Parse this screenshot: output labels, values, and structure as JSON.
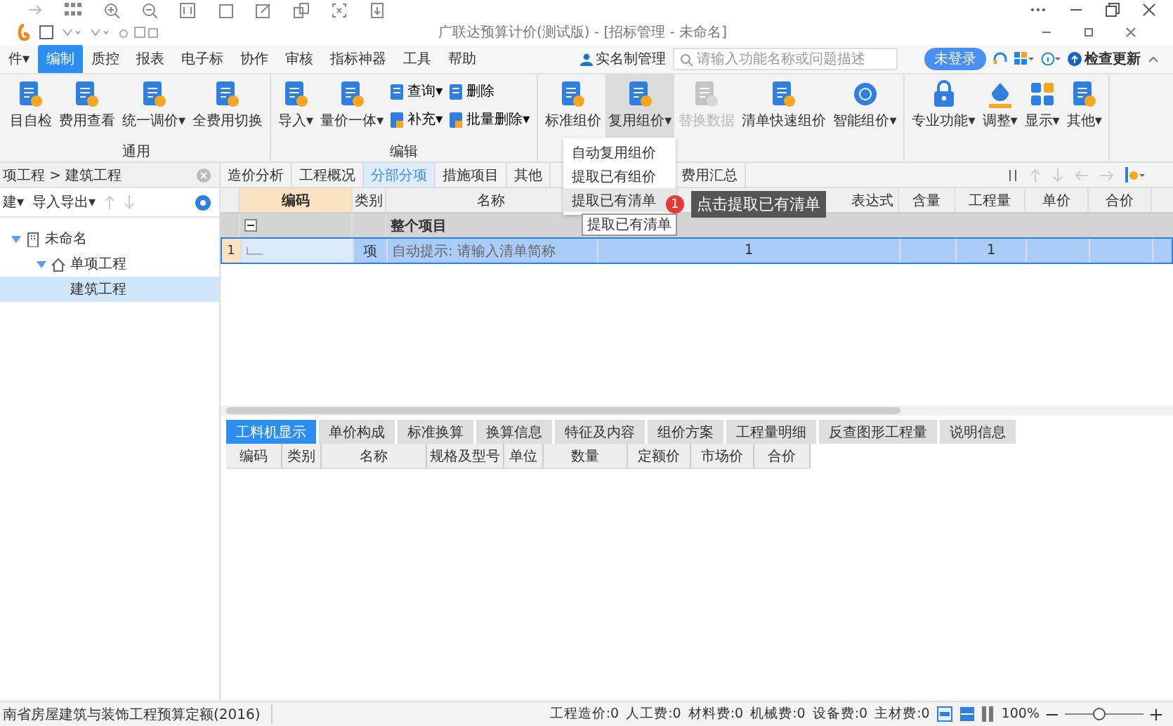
{
  "window": {
    "title": "广联达预算计价(测试版) - [招标管理 - 未命名]"
  },
  "menu": [
    {
      "label": "件▾",
      "selected": false
    },
    {
      "label": "编制",
      "selected": true
    },
    {
      "label": "质控",
      "selected": false
    },
    {
      "label": "报表",
      "selected": false
    },
    {
      "label": "电子标",
      "selected": false
    },
    {
      "label": "协作",
      "selected": false
    },
    {
      "label": "审核",
      "selected": false
    },
    {
      "label": "指标神器",
      "selected": false
    },
    {
      "label": "工具",
      "selected": false
    },
    {
      "label": "帮助",
      "selected": false
    }
  ],
  "account": {
    "realname": "实名制管理",
    "search_placeholder": "请输入功能名称或问题描述",
    "login": "未登录",
    "update": "检查更新"
  },
  "ribbon": [
    {
      "label": "通用",
      "items": [
        {
          "kind": "large",
          "label": "目自检",
          "active": false,
          "disabled": false
        },
        {
          "kind": "large",
          "label": "费用查看",
          "active": false,
          "disabled": false
        },
        {
          "kind": "large",
          "label": "统一调价▾",
          "active": false,
          "disabled": false
        },
        {
          "kind": "large",
          "label": "全费用切换",
          "active": false,
          "disabled": false
        }
      ]
    },
    {
      "label": "编辑",
      "items": [
        {
          "kind": "large",
          "label": "导入▾",
          "active": false,
          "disabled": false
        },
        {
          "kind": "large",
          "label": "量价一体▾",
          "active": false,
          "disabled": false
        },
        {
          "kind": "small",
          "top": "查询▾",
          "bottom": "补充▾"
        },
        {
          "kind": "small",
          "top": "删除",
          "bottom": "批量删除▾"
        }
      ]
    },
    {
      "items": [
        {
          "kind": "large",
          "label": "标准组价",
          "active": false,
          "disabled": false
        },
        {
          "kind": "large",
          "label": "复用组价▾",
          "active": true,
          "disabled": false
        },
        {
          "kind": "large",
          "label": "替换数据",
          "active": false,
          "disabled": true
        },
        {
          "kind": "large",
          "label": "清单快速组价",
          "active": false,
          "disabled": false
        },
        {
          "kind": "large",
          "label": "智能组价▾",
          "active": false,
          "disabled": false
        }
      ]
    },
    {
      "items": [
        {
          "kind": "large",
          "label": "专业功能▾",
          "active": false,
          "disabled": false
        },
        {
          "kind": "large",
          "label": "调整▾",
          "active": false,
          "disabled": false
        },
        {
          "kind": "large",
          "label": "显示▾",
          "active": false,
          "disabled": false
        },
        {
          "kind": "large",
          "label": "其他▾",
          "active": false,
          "disabled": false
        }
      ]
    }
  ],
  "dropdown": [
    {
      "label": "自动复用组价",
      "selected": false
    },
    {
      "label": "提取已有组价",
      "selected": false
    },
    {
      "label": "提取已有清单",
      "selected": true
    }
  ],
  "tooltip": "提取已有清单",
  "callout": {
    "badge": "1",
    "text": "点击提取已有清单"
  },
  "sidebar": {
    "breadcrumb": "项工程 > 建筑工程",
    "toolbar": [
      "建▾",
      "导入导出▾"
    ],
    "tree": [
      {
        "label": "未命名",
        "expanded": true,
        "selected": false,
        "children": [
          {
            "label": "单项工程",
            "expanded": true,
            "selected": false,
            "children": [
              {
                "label": "建筑工程",
                "selected": true
              }
            ]
          }
        ]
      }
    ]
  },
  "tabs": [
    {
      "label": "造价分析",
      "selected": false
    },
    {
      "label": "工程概况",
      "selected": false
    },
    {
      "label": "分部分项",
      "selected": true
    },
    {
      "label": "措施项目",
      "selected": false
    },
    {
      "label": "其他",
      "selected": false
    },
    {
      "label": "费用汇总",
      "selected": false
    }
  ],
  "grid": {
    "columns": [
      "编码",
      "类别",
      "名称",
      "表达式",
      "含量",
      "工程量",
      "单价",
      "合价"
    ],
    "rows": [
      {
        "kind": "group",
        "expanded": true,
        "name": "整个项目"
      },
      {
        "kind": "item",
        "index": "1",
        "type": "项",
        "name": "自动提示: 请输入清单简称",
        "expr": "1",
        "quantity": "1",
        "selected": true
      }
    ]
  },
  "bottom_tabs": [
    {
      "label": "工料机显示",
      "selected": true
    },
    {
      "label": "单价构成",
      "selected": false
    },
    {
      "label": "标准换算",
      "selected": false
    },
    {
      "label": "换算信息",
      "selected": false
    },
    {
      "label": "特征及内容",
      "selected": false
    },
    {
      "label": "组价方案",
      "selected": false
    },
    {
      "label": "工程量明细",
      "selected": false
    },
    {
      "label": "反查图形工程量",
      "selected": false
    },
    {
      "label": "说明信息",
      "selected": false
    }
  ],
  "bottom_columns": [
    "编码",
    "类别",
    "名称",
    "规格及型号",
    "单位",
    "数量",
    "定额价",
    "市场价",
    "合价"
  ],
  "status_bar": {
    "norm": "南省房屋建筑与装饰工程预算定额(2016)",
    "totals": [
      "工程造价:0",
      "人工费:0",
      "材料费:0",
      "机械费:0",
      "设备费:0",
      "主材费:0"
    ],
    "zoom": "100%",
    "level": 0.45
  }
}
